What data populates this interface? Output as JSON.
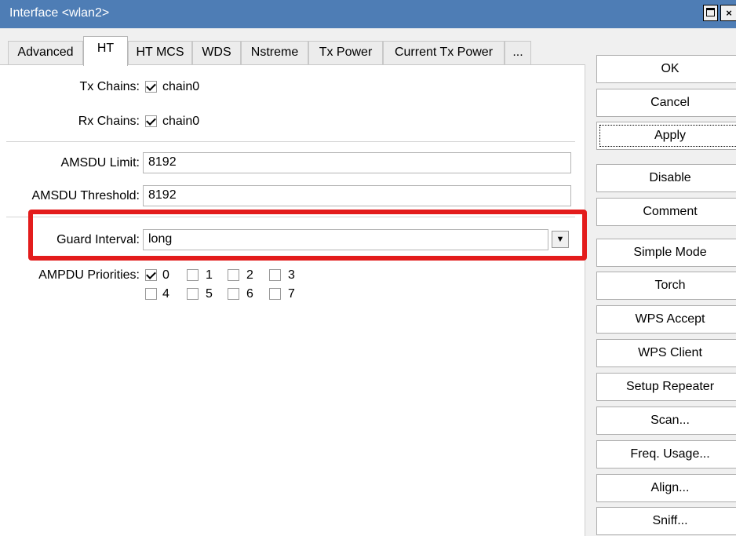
{
  "window": {
    "title": "Interface <wlan2>",
    "close_glyph": "×"
  },
  "tabs": [
    "Advanced",
    "HT",
    "HT MCS",
    "WDS",
    "Nstreme",
    "Tx Power",
    "Current Tx Power",
    "..."
  ],
  "active_tab": "HT",
  "tx_chains": {
    "label": "Tx Chains:",
    "option": "chain0",
    "checked": true
  },
  "rx_chains": {
    "label": "Rx Chains:",
    "option": "chain0",
    "checked": true
  },
  "amsdu_limit": {
    "label": "AMSDU Limit:",
    "value": "8192"
  },
  "amsdu_threshold": {
    "label": "AMSDU Threshold:",
    "value": "8192"
  },
  "guard_interval": {
    "label": "Guard Interval:",
    "value": "long",
    "dropdown_icon": "dropdown-arrow-icon"
  },
  "ampdu_priorities": {
    "label": "AMPDU Priorities:",
    "items": [
      {
        "label": "0",
        "checked": true
      },
      {
        "label": "1",
        "checked": false
      },
      {
        "label": "2",
        "checked": false
      },
      {
        "label": "3",
        "checked": false
      },
      {
        "label": "4",
        "checked": false
      },
      {
        "label": "5",
        "checked": false
      },
      {
        "label": "6",
        "checked": false
      },
      {
        "label": "7",
        "checked": false
      }
    ]
  },
  "buttons": [
    "OK",
    "Cancel",
    "Apply",
    "Disable",
    "Comment",
    "Simple Mode",
    "Torch",
    "WPS Accept",
    "WPS Client",
    "Setup Repeater",
    "Scan...",
    "Freq. Usage...",
    "Align...",
    "Sniff..."
  ],
  "colors": {
    "titlebar": "#4e7db5",
    "highlight": "#e31c1c"
  }
}
